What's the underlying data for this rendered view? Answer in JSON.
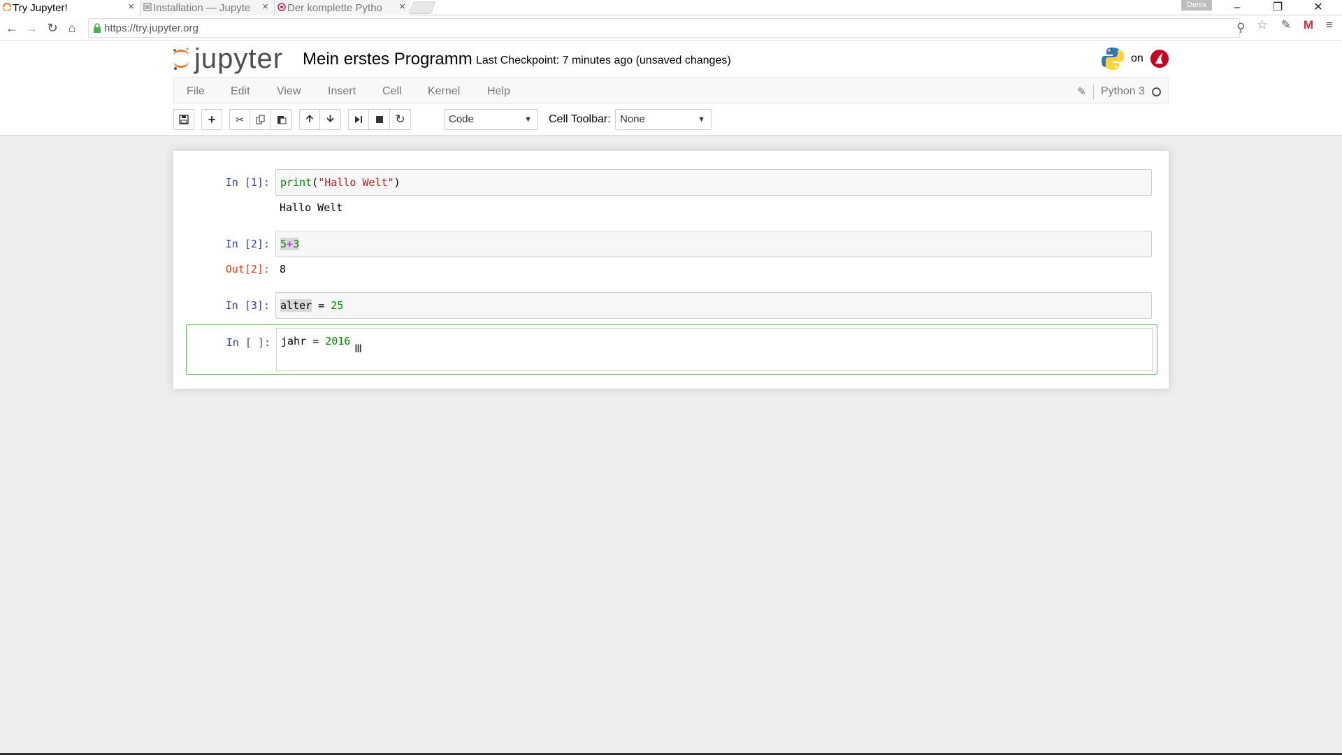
{
  "browser": {
    "tabs": [
      {
        "label": "Try Jupyter!",
        "active": true
      },
      {
        "label": "Installation — Jupyte",
        "active": false
      },
      {
        "label": "Der komplette Pytho",
        "active": false
      }
    ],
    "close_glyph": "×",
    "profile": "Denis",
    "url": "https://try.jupyter.org"
  },
  "header": {
    "logo_text": "jupyter",
    "notebook_title": "Mein erstes Programm",
    "checkpoint": "Last Checkpoint: 7 minutes ago (unsaved changes)",
    "on_text": "on"
  },
  "menu": {
    "items": [
      "File",
      "Edit",
      "View",
      "Insert",
      "Cell",
      "Kernel",
      "Help"
    ],
    "kernel_name": "Python 3"
  },
  "toolbar": {
    "cell_type": "Code",
    "cell_toolbar_label": "Cell Toolbar:",
    "cell_toolbar_value": "None"
  },
  "cells": [
    {
      "prompt": "In [1]:",
      "code": {
        "fn": "print",
        "open": "(",
        "str": "\"Hallo Welt\"",
        "close": ")"
      },
      "output": "Hallo Welt"
    },
    {
      "prompt": "In [2]:",
      "code": {
        "a": "5",
        "op": "+",
        "b": "3"
      },
      "out_prompt": "Out[2]:",
      "output": "8"
    },
    {
      "prompt": "In [3]:",
      "code": {
        "var": "alter",
        "eq": " = ",
        "num": "25"
      }
    },
    {
      "prompt": "In [ ]:",
      "code": {
        "var": "jahr",
        "eq": " = ",
        "num": "2016"
      },
      "selected": true
    }
  ],
  "colors": {
    "prompt_in": "#303f9f",
    "prompt_out": "#d84315",
    "selected_border": "#66bb6a",
    "jupyter_orange": "#f37626"
  }
}
